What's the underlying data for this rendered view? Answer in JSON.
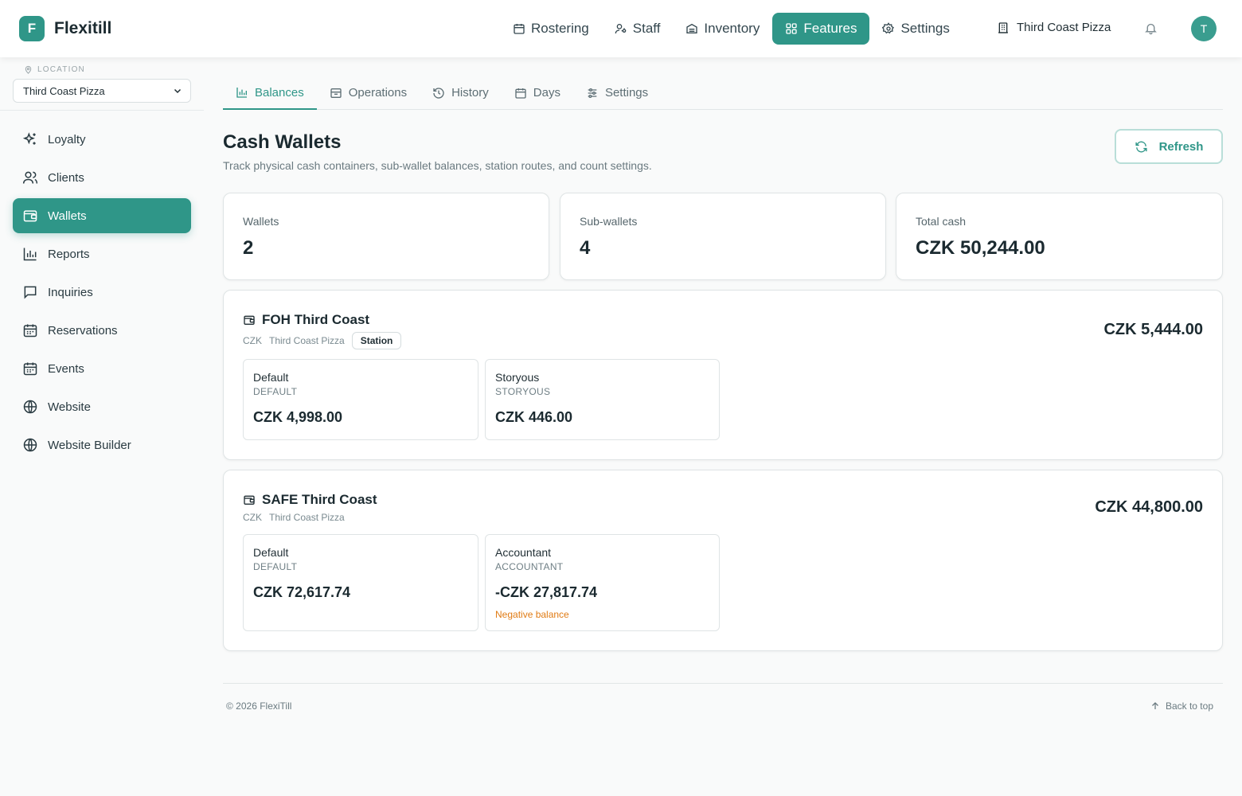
{
  "header": {
    "logo_letter": "F",
    "brand": "Flexitill",
    "nav": [
      {
        "label": "Rostering",
        "icon": "calendar-icon"
      },
      {
        "label": "Staff",
        "icon": "user-key-icon"
      },
      {
        "label": "Inventory",
        "icon": "box-icon"
      },
      {
        "label": "Features",
        "icon": "grid-icon",
        "active": true
      },
      {
        "label": "Settings",
        "icon": "gear-icon"
      }
    ],
    "venue": "Third Coast Pizza",
    "avatar_initial": "T"
  },
  "sidebar": {
    "location_label": "LOCATION",
    "location_value": "Third Coast Pizza",
    "items": [
      {
        "label": "Loyalty",
        "icon": "sparkles-icon"
      },
      {
        "label": "Clients",
        "icon": "users-icon"
      },
      {
        "label": "Wallets",
        "icon": "wallet-icon",
        "active": true
      },
      {
        "label": "Reports",
        "icon": "bar-chart-icon"
      },
      {
        "label": "Inquiries",
        "icon": "message-icon"
      },
      {
        "label": "Reservations",
        "icon": "calendar-icon"
      },
      {
        "label": "Events",
        "icon": "calendar-icon"
      },
      {
        "label": "Website",
        "icon": "globe-icon"
      },
      {
        "label": "Website Builder",
        "icon": "globe-icon"
      }
    ]
  },
  "tabs": [
    {
      "label": "Balances",
      "icon": "bar-chart-icon",
      "active": true
    },
    {
      "label": "Operations",
      "icon": "archive-icon"
    },
    {
      "label": "History",
      "icon": "history-icon"
    },
    {
      "label": "Days",
      "icon": "calendar-icon"
    },
    {
      "label": "Settings",
      "icon": "sliders-icon"
    }
  ],
  "page": {
    "title": "Cash Wallets",
    "subtitle": "Track physical cash containers, sub-wallet balances, station routes, and count settings.",
    "refresh_label": "Refresh"
  },
  "stats": [
    {
      "label": "Wallets",
      "value": "2"
    },
    {
      "label": "Sub-wallets",
      "value": "4"
    },
    {
      "label": "Total cash",
      "value": "CZK 50,244.00"
    }
  ],
  "wallets": [
    {
      "name": "FOH Third Coast",
      "currency": "CZK",
      "location": "Third Coast Pizza",
      "badge": "Station",
      "total": "CZK 5,444.00",
      "subwallets": [
        {
          "name": "Default",
          "code": "DEFAULT",
          "amount": "CZK 4,998.00"
        },
        {
          "name": "Storyous",
          "code": "STORYOUS",
          "amount": "CZK 446.00"
        }
      ]
    },
    {
      "name": "SAFE Third Coast",
      "currency": "CZK",
      "location": "Third Coast Pizza",
      "total": "CZK 44,800.00",
      "subwallets": [
        {
          "name": "Default",
          "code": "DEFAULT",
          "amount": "CZK 72,617.74"
        },
        {
          "name": "Accountant",
          "code": "ACCOUNTANT",
          "amount": "-CZK 27,817.74",
          "warning": "Negative balance"
        }
      ]
    }
  ],
  "footer": {
    "copyright": "© 2026 FlexiTill",
    "back_to_top": "Back to top"
  },
  "colors": {
    "accent": "#2f9688",
    "warning": "#e07b14"
  }
}
